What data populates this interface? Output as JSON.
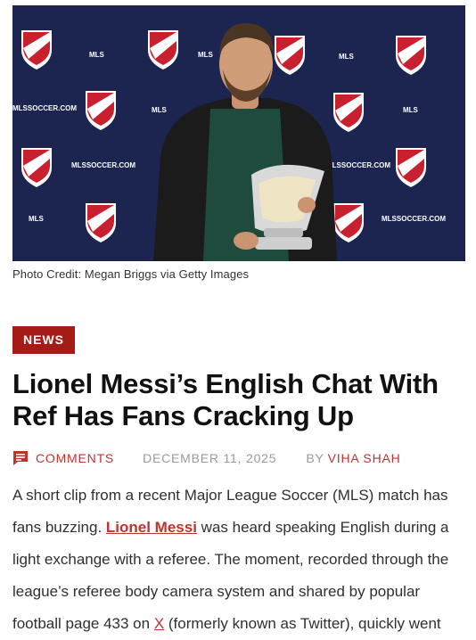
{
  "hero": {
    "backdrop_texts": {
      "mls_small": "MLS",
      "mls_soccer": "MLSSOCCER.COM",
      "mls_word": "MLS"
    },
    "colors": {
      "backdrop": "#1c2450",
      "crest_red": "#c8202f",
      "crest_white": "#ffffff",
      "jacket": "#1b1b1b",
      "shirt": "#1f4a3e",
      "trophy": "#d9d9d9"
    }
  },
  "photo_credit": "Photo Credit: Megan Briggs via Getty Images",
  "category": "NEWS",
  "title": "Lionel Messi’s English Chat With Ref Has Fans Cracking Up",
  "meta": {
    "comments_label": "COMMENTS",
    "date": "DECEMBER 11, 2025",
    "by_label": "BY",
    "author": "VIHA SHAH",
    "comment_icon": "comment-icon"
  },
  "body": {
    "text_1": "A short clip from a recent Major League Soccer (MLS) match has fans buzzing. ",
    "link_messi": "Lionel Messi",
    "text_2": " was heard speaking English during a light exchange with a referee. The moment, recorded through the league’s referee body camera system and shared by popular football page 433 on ",
    "link_x": "X",
    "text_3": " (formerly known as Twitter), quickly went"
  },
  "colors": {
    "accent": "#c0332c",
    "badge": "#a51c16",
    "meta_grey": "#9a9a9a"
  }
}
